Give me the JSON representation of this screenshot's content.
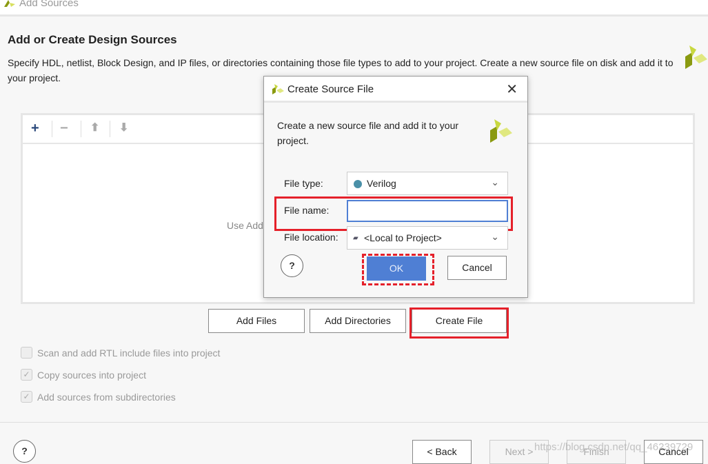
{
  "window": {
    "title": "Add Sources"
  },
  "page": {
    "heading": "Add or Create Design Sources",
    "description": "Specify HDL, netlist, Block Design, and IP files, or directories containing those file types to add to your project. Create a new source file on disk and add it to your project."
  },
  "panel": {
    "hint": "Use Add"
  },
  "actions": {
    "add_files": "Add Files",
    "add_directories": "Add Directories",
    "create_file": "Create File"
  },
  "options": [
    {
      "label": "Scan and add RTL include files into project",
      "checked": false
    },
    {
      "label": "Copy sources into project",
      "checked": true
    },
    {
      "label": "Add sources from subdirectories",
      "checked": true
    }
  ],
  "footer": {
    "help": "?",
    "back": "< Back",
    "next": "Next >",
    "finish": "Finish",
    "cancel": "Cancel"
  },
  "dialog": {
    "title": "Create Source File",
    "description": "Create a new source file and add it to your project.",
    "file_type_label": "File type:",
    "file_type_value": "Verilog",
    "file_name_label": "File name:",
    "file_name_value": "",
    "file_location_label": "File location:",
    "file_location_value": "<Local to Project>",
    "help": "?",
    "ok": "OK",
    "cancel": "Cancel"
  },
  "colors": {
    "highlight": "#e5202a",
    "ok_button": "#4f7fd4",
    "verilog_dot": "#4a90a8"
  },
  "watermark": "https://blog.csdn.net/qq_46239729"
}
